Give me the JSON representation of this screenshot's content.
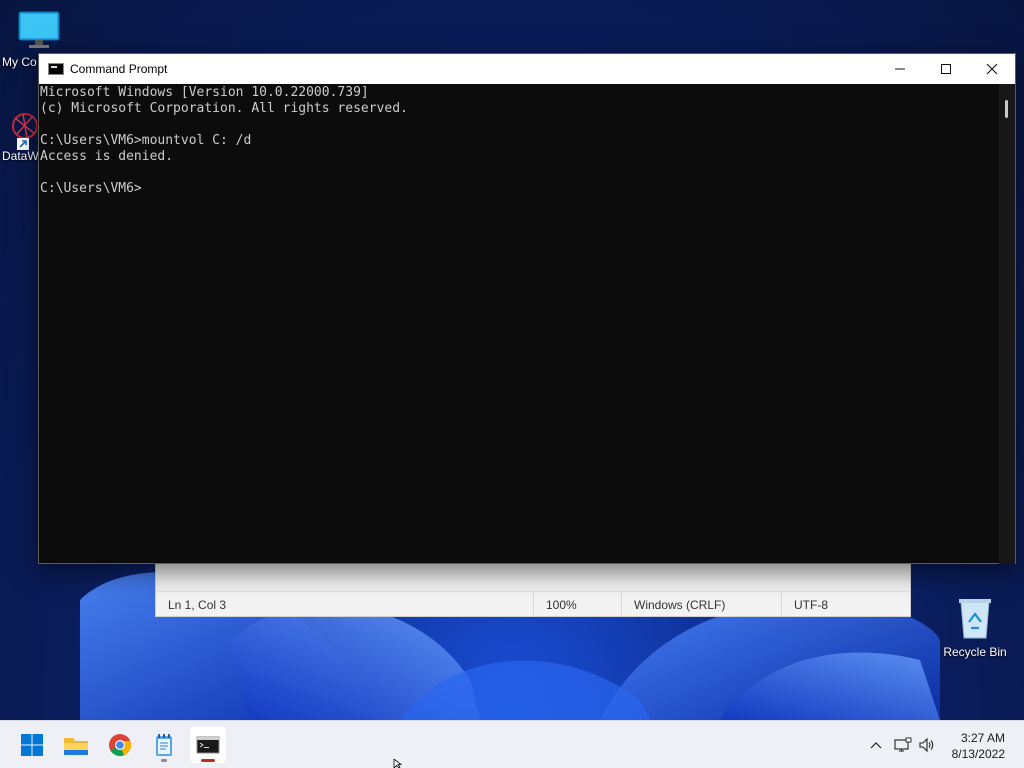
{
  "desktop": {
    "icons": [
      {
        "label": "My Computer",
        "label_visible": "My Co"
      },
      {
        "label": "DataW"
      },
      {
        "label": "Recycle Bin"
      }
    ]
  },
  "cmd_window": {
    "title": "Command Prompt",
    "console_lines": [
      "Microsoft Windows [Version 10.0.22000.739]",
      "(c) Microsoft Corporation. All rights reserved.",
      "",
      "C:\\Users\\VM6>mountvol C: /d",
      "Access is denied.",
      "",
      "C:\\Users\\VM6>"
    ],
    "buttons": {
      "minimize": "minimize-icon",
      "maximize": "maximize-icon",
      "close": "close-icon"
    }
  },
  "notepad": {
    "status": {
      "position": "Ln 1, Col 3",
      "zoom": "100%",
      "line_ending": "Windows (CRLF)",
      "encoding": "UTF-8"
    }
  },
  "taskbar": {
    "apps": [
      "start-icon",
      "file-explorer-icon",
      "chrome-icon",
      "notepad-icon",
      "command-prompt-icon"
    ],
    "clock": {
      "time": "3:27 AM",
      "date": "8/13/2022"
    }
  },
  "colors": {
    "console_bg": "#0c0c0c",
    "console_text": "#cccccc",
    "active_indicator": "#c42b1c",
    "windows_blue": "#0078d4"
  }
}
